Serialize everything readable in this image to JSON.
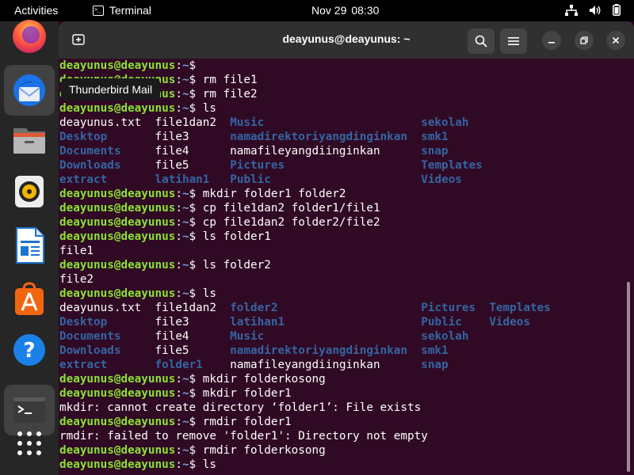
{
  "topbar": {
    "activities": "Activities",
    "app_name": "Terminal",
    "date": "Nov 29",
    "time": "08:30"
  },
  "dock": {
    "tooltip": "Thunderbird Mail"
  },
  "window": {
    "title": "deayunus@deayunus: ~"
  },
  "colors": {
    "prompt_user": "#8ae234",
    "prompt_path": "#729fcf",
    "directory": "#3465a4",
    "terminal_bg": "#300a24"
  },
  "terminal": {
    "lines": [
      [
        {
          "t": "deayunus@deayunus",
          "c": "u"
        },
        {
          "t": ":",
          "c": "w"
        },
        {
          "t": "~",
          "c": "p"
        },
        {
          "t": "$ ",
          "c": "w"
        }
      ],
      [
        {
          "t": "deayunus@deayunus",
          "c": "u"
        },
        {
          "t": ":",
          "c": "w"
        },
        {
          "t": "~",
          "c": "p"
        },
        {
          "t": "$ rm file1",
          "c": "w"
        }
      ],
      [
        {
          "t": "deayunus@deayunus",
          "c": "u"
        },
        {
          "t": ":",
          "c": "w"
        },
        {
          "t": "~",
          "c": "p"
        },
        {
          "t": "$ rm file2",
          "c": "w"
        }
      ],
      [
        {
          "t": "deayunus@deayunus",
          "c": "u"
        },
        {
          "t": ":",
          "c": "w"
        },
        {
          "t": "~",
          "c": "p"
        },
        {
          "t": "$ ls",
          "c": "w"
        }
      ],
      [
        {
          "t": "deayunus.txt  file1dan2  ",
          "c": "w"
        },
        {
          "t": "Music",
          "c": "d"
        },
        {
          "t": "                       ",
          "c": "w"
        },
        {
          "t": "sekolah",
          "c": "d"
        }
      ],
      [
        {
          "t": "Desktop",
          "c": "d"
        },
        {
          "t": "       file3      ",
          "c": "w"
        },
        {
          "t": "namadirektoriyangdinginkan",
          "c": "d"
        },
        {
          "t": "  ",
          "c": "w"
        },
        {
          "t": "smk1",
          "c": "d"
        }
      ],
      [
        {
          "t": "Documents",
          "c": "d"
        },
        {
          "t": "     file4      namafileyangdiinginkan      ",
          "c": "w"
        },
        {
          "t": "snap",
          "c": "d"
        }
      ],
      [
        {
          "t": "Downloads",
          "c": "d"
        },
        {
          "t": "     file5      ",
          "c": "w"
        },
        {
          "t": "Pictures",
          "c": "d"
        },
        {
          "t": "                    ",
          "c": "w"
        },
        {
          "t": "Templates",
          "c": "d"
        }
      ],
      [
        {
          "t": "extract",
          "c": "d"
        },
        {
          "t": "       ",
          "c": "w"
        },
        {
          "t": "latihan1",
          "c": "d"
        },
        {
          "t": "   ",
          "c": "w"
        },
        {
          "t": "Public",
          "c": "d"
        },
        {
          "t": "                      ",
          "c": "w"
        },
        {
          "t": "Videos",
          "c": "d"
        }
      ],
      [
        {
          "t": "deayunus@deayunus",
          "c": "u"
        },
        {
          "t": ":",
          "c": "w"
        },
        {
          "t": "~",
          "c": "p"
        },
        {
          "t": "$ mkdir folder1 folder2",
          "c": "w"
        }
      ],
      [
        {
          "t": "deayunus@deayunus",
          "c": "u"
        },
        {
          "t": ":",
          "c": "w"
        },
        {
          "t": "~",
          "c": "p"
        },
        {
          "t": "$ cp file1dan2 folder1/file1",
          "c": "w"
        }
      ],
      [
        {
          "t": "deayunus@deayunus",
          "c": "u"
        },
        {
          "t": ":",
          "c": "w"
        },
        {
          "t": "~",
          "c": "p"
        },
        {
          "t": "$ cp file1dan2 folder2/file2",
          "c": "w"
        }
      ],
      [
        {
          "t": "deayunus@deayunus",
          "c": "u"
        },
        {
          "t": ":",
          "c": "w"
        },
        {
          "t": "~",
          "c": "p"
        },
        {
          "t": "$ ls folder1",
          "c": "w"
        }
      ],
      [
        {
          "t": "file1",
          "c": "w"
        }
      ],
      [
        {
          "t": "deayunus@deayunus",
          "c": "u"
        },
        {
          "t": ":",
          "c": "w"
        },
        {
          "t": "~",
          "c": "p"
        },
        {
          "t": "$ ls folder2",
          "c": "w"
        }
      ],
      [
        {
          "t": "file2",
          "c": "w"
        }
      ],
      [
        {
          "t": "deayunus@deayunus",
          "c": "u"
        },
        {
          "t": ":",
          "c": "w"
        },
        {
          "t": "~",
          "c": "p"
        },
        {
          "t": "$ ls",
          "c": "w"
        }
      ],
      [
        {
          "t": "deayunus.txt  file1dan2  ",
          "c": "w"
        },
        {
          "t": "folder2",
          "c": "d"
        },
        {
          "t": "                     ",
          "c": "w"
        },
        {
          "t": "Pictures",
          "c": "d"
        },
        {
          "t": "  ",
          "c": "w"
        },
        {
          "t": "Templates",
          "c": "d"
        }
      ],
      [
        {
          "t": "Desktop",
          "c": "d"
        },
        {
          "t": "       file3      ",
          "c": "w"
        },
        {
          "t": "latihan1",
          "c": "d"
        },
        {
          "t": "                    ",
          "c": "w"
        },
        {
          "t": "Public",
          "c": "d"
        },
        {
          "t": "    ",
          "c": "w"
        },
        {
          "t": "Videos",
          "c": "d"
        }
      ],
      [
        {
          "t": "Documents",
          "c": "d"
        },
        {
          "t": "     file4      ",
          "c": "w"
        },
        {
          "t": "Music",
          "c": "d"
        },
        {
          "t": "                       ",
          "c": "w"
        },
        {
          "t": "sekolah",
          "c": "d"
        }
      ],
      [
        {
          "t": "Downloads",
          "c": "d"
        },
        {
          "t": "     file5      ",
          "c": "w"
        },
        {
          "t": "namadirektoriyangdinginkan",
          "c": "d"
        },
        {
          "t": "  ",
          "c": "w"
        },
        {
          "t": "smk1",
          "c": "d"
        }
      ],
      [
        {
          "t": "extract",
          "c": "d"
        },
        {
          "t": "       ",
          "c": "w"
        },
        {
          "t": "folder1",
          "c": "d"
        },
        {
          "t": "    namafileyangdiinginkan      ",
          "c": "w"
        },
        {
          "t": "snap",
          "c": "d"
        }
      ],
      [
        {
          "t": "deayunus@deayunus",
          "c": "u"
        },
        {
          "t": ":",
          "c": "w"
        },
        {
          "t": "~",
          "c": "p"
        },
        {
          "t": "$ mkdir folderkosong",
          "c": "w"
        }
      ],
      [
        {
          "t": "deayunus@deayunus",
          "c": "u"
        },
        {
          "t": ":",
          "c": "w"
        },
        {
          "t": "~",
          "c": "p"
        },
        {
          "t": "$ mkdir folder1",
          "c": "w"
        }
      ],
      [
        {
          "t": "mkdir: cannot create directory ‘folder1’: File exists",
          "c": "w"
        }
      ],
      [
        {
          "t": "deayunus@deayunus",
          "c": "u"
        },
        {
          "t": ":",
          "c": "w"
        },
        {
          "t": "~",
          "c": "p"
        },
        {
          "t": "$ rmdir folder1",
          "c": "w"
        }
      ],
      [
        {
          "t": "rmdir: failed to remove 'folder1': Directory not empty",
          "c": "w"
        }
      ],
      [
        {
          "t": "deayunus@deayunus",
          "c": "u"
        },
        {
          "t": ":",
          "c": "w"
        },
        {
          "t": "~",
          "c": "p"
        },
        {
          "t": "$ rmdir folderkosong",
          "c": "w"
        }
      ],
      [
        {
          "t": "deayunus@deayunus",
          "c": "u"
        },
        {
          "t": ":",
          "c": "w"
        },
        {
          "t": "~",
          "c": "p"
        },
        {
          "t": "$ ls",
          "c": "w"
        }
      ]
    ]
  }
}
